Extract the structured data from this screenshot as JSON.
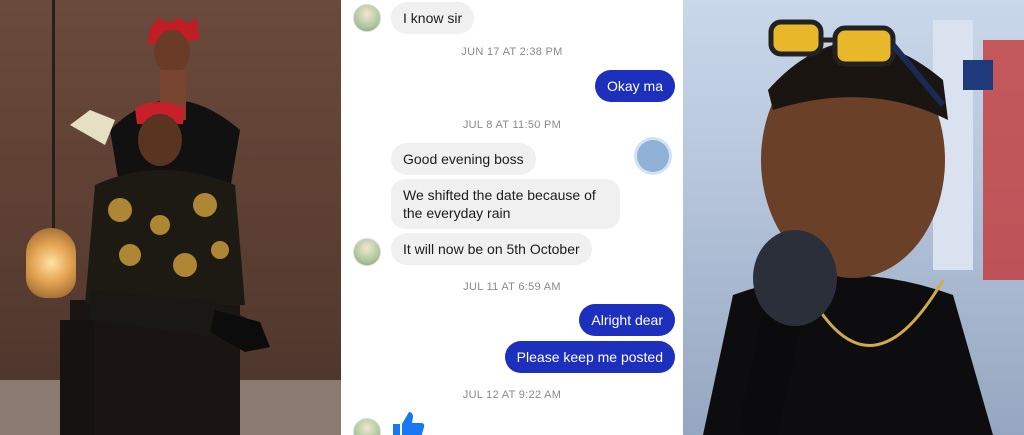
{
  "chat": {
    "messages": [
      {
        "text": "I know sir"
      },
      {
        "timestamp": "JUN 17 AT 2:38 PM"
      },
      {
        "text": "Okay ma"
      },
      {
        "timestamp": "JUL 8 AT 11:50 PM"
      },
      {
        "text": "Good evening boss"
      },
      {
        "text_line1": "We shifted the date because of",
        "text_line2": "the everyday rain"
      },
      {
        "text": "It will now be on 5th October"
      },
      {
        "timestamp": "JUL 11 AT 6:59 AM"
      },
      {
        "text": "Alright dear"
      },
      {
        "text": "Please keep me posted"
      },
      {
        "timestamp": "JUL 12 AT 9:22 AM"
      }
    ],
    "colors": {
      "outgoing": "#1c2fbd",
      "incoming": "#f0f0f0",
      "timestamp": "#8a8a8a"
    }
  },
  "icons": [
    "avatar",
    "typing-indicator",
    "thumbs-up-icon"
  ]
}
